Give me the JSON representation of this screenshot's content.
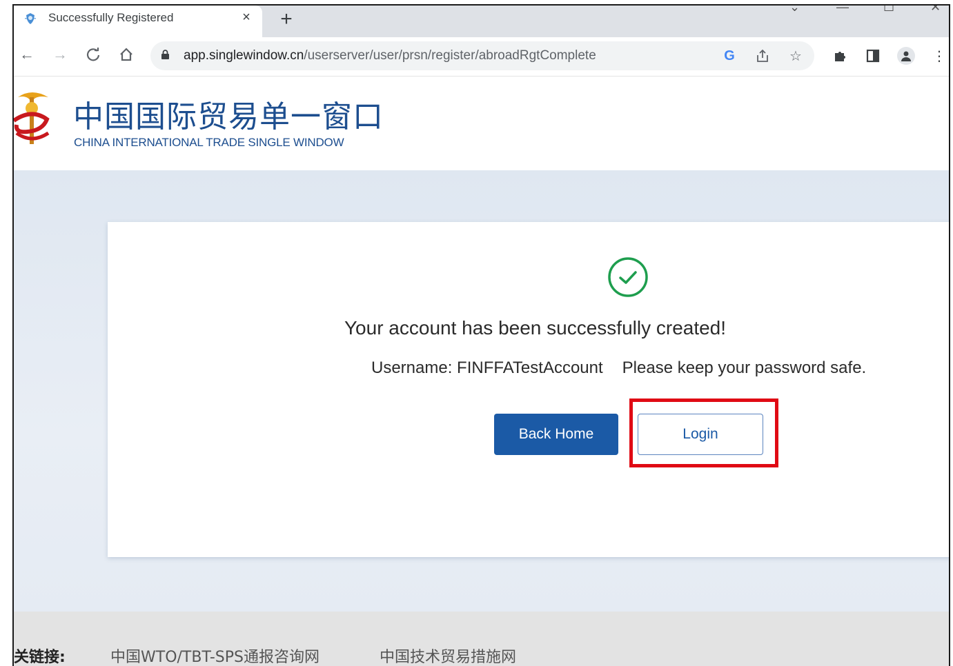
{
  "browser": {
    "tab_title": "Successfully Registered",
    "tab_close": "×",
    "new_tab": "+",
    "url_host": "app.singlewindow.cn",
    "url_path": "/userserver/user/prsn/register/abroadRgtComplete"
  },
  "site": {
    "logo_cn": "中国国际贸易单一窗口",
    "logo_en": "CHINA INTERNATIONAL TRADE SINGLE WINDOW"
  },
  "card": {
    "success_message": "Your account has been successfully created!",
    "username_label": "Username: FINFFATestAccount",
    "password_note": "Please keep your password safe.",
    "back_home_label": "Back Home",
    "login_label": "Login"
  },
  "footer": {
    "label": "关链接:",
    "links": [
      "中国WTO/TBT-SPS通报咨询网",
      "中国技术贸易措施网"
    ]
  },
  "colors": {
    "brand_blue": "#1b5aa6",
    "success_green": "#1e9e4e",
    "highlight_red": "#e00a14"
  }
}
